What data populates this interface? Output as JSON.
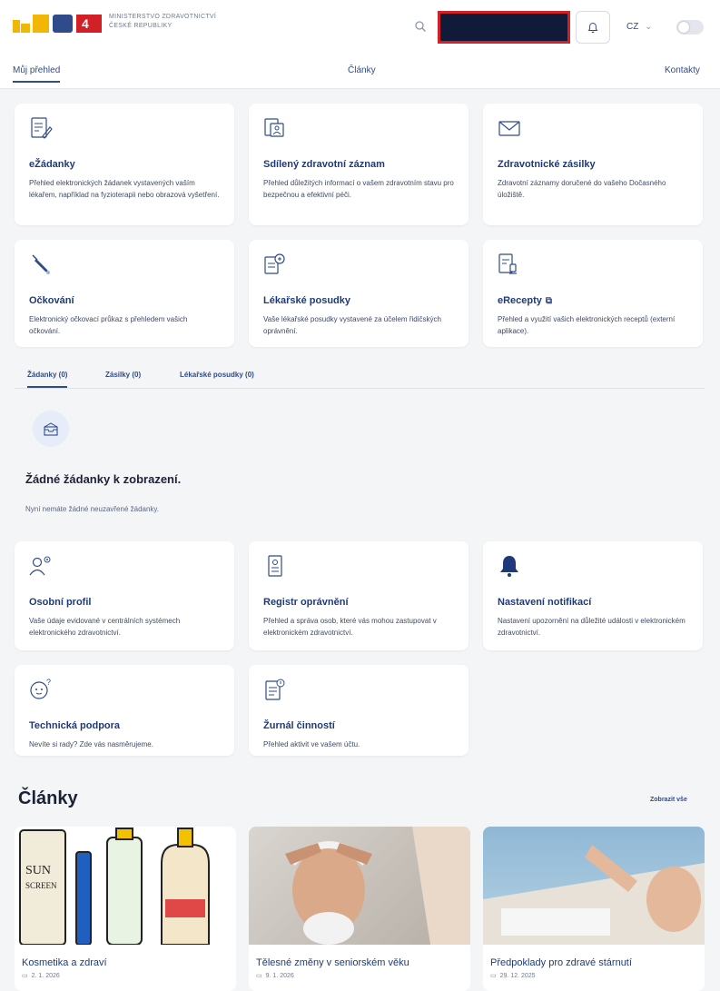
{
  "header": {
    "ministry_line1": "MINISTERSTVO ZDRAVOTNICTVÍ",
    "ministry_line2": "ČESKÉ REPUBLIKY",
    "language": "CZ",
    "colors": {
      "brand_blue": "#2f4b8a",
      "dark_navy": "#121a3a",
      "highlight_red": "#d32026"
    }
  },
  "nav": {
    "tabs": [
      {
        "label": "Můj přehled",
        "active": true
      },
      {
        "label": "Články",
        "active": false
      },
      {
        "label": "Kontakty",
        "active": false
      }
    ]
  },
  "services": [
    {
      "icon": "document-edit-icon",
      "title": "eŽádanky",
      "desc": "Přehled elektronických žádanek vystavených vaším lékařem, například na fyzioterapii nebo obrazová vyšetření."
    },
    {
      "icon": "medical-record-icon",
      "title": "Sdílený zdravotní záznam",
      "desc": "Přehled důležitých informací o vašem zdravotním stavu pro bezpečnou a efektivní péči."
    },
    {
      "icon": "envelope-icon",
      "title": "Zdravotnické zásilky",
      "desc": "Zdravotní záznamy doručené do vašeho Dočasného úložiště."
    },
    {
      "icon": "syringe-icon",
      "title": "Očkování",
      "desc": "Elektronický očkovací průkaz s přehledem vašich očkování."
    },
    {
      "icon": "medical-report-icon",
      "title": "Lékařské posudky",
      "desc": "Vaše lékařské posudky vystavené za účelem řidičských oprávnění."
    },
    {
      "icon": "prescription-icon",
      "title": "eRecepty",
      "desc": "Přehled a využití vašich elektronických receptů (externí aplikace)."
    }
  ],
  "subtabs": [
    {
      "label": "Žádanky (0)",
      "active": true
    },
    {
      "label": "Zásilky (0)",
      "active": false
    },
    {
      "label": "Lékařské posudky (0)",
      "active": false
    }
  ],
  "empty_state": {
    "icon": "empty-inbox-icon",
    "title": "Žádné žádanky k zobrazení.",
    "desc": "Nyní nemáte žádné neuzavřené žádanky."
  },
  "settings": [
    {
      "icon": "person-settings-icon",
      "title": "Osobní profil",
      "desc": "Vaše údaje evidované v centrálních systémech elektronického zdravotnictví."
    },
    {
      "icon": "id-badge-icon",
      "title": "Registr oprávnění",
      "desc": "Přehled a správa osob, které vás mohou zastupovat v elektronickém zdravotnictví."
    },
    {
      "icon": "bell-icon",
      "title": "Nastavení notifikací",
      "desc": "Nastavení upozornění na důležité události v elektronickém zdravotnictví."
    },
    {
      "icon": "support-face-icon",
      "title": "Technická podpora",
      "desc": "Nevíte si rady? Zde vás nasměrujeme."
    },
    {
      "icon": "activity-log-icon",
      "title": "Žurnál činností",
      "desc": "Přehled aktivit ve vašem účtu."
    }
  ],
  "articles": {
    "heading": "Články",
    "show_all": "Zobrazit vše",
    "items": [
      {
        "title": "Kosmetika a zdraví",
        "date": "2. 1. 2026"
      },
      {
        "title": "Tělesné změny v seniorském věku",
        "date": "9. 1. 2026"
      },
      {
        "title": "Předpoklady pro zdravé stárnutí",
        "date": "29. 12. 2025"
      }
    ]
  }
}
